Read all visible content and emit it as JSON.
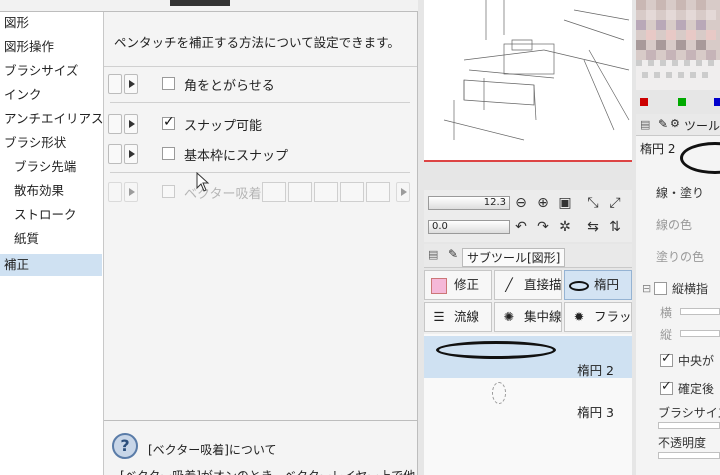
{
  "categories": [
    {
      "label": "図形",
      "sub": false,
      "selected": false
    },
    {
      "label": "図形操作",
      "sub": false,
      "selected": false
    },
    {
      "label": "ブラシサイズ",
      "sub": false,
      "selected": false
    },
    {
      "label": "インク",
      "sub": false,
      "selected": false
    },
    {
      "label": "アンチエイリアス",
      "sub": false,
      "selected": false
    },
    {
      "label": "ブラシ形状",
      "sub": false,
      "selected": false
    },
    {
      "label": "ブラシ先端",
      "sub": true,
      "selected": false
    },
    {
      "label": "散布効果",
      "sub": true,
      "selected": false
    },
    {
      "label": "ストローク",
      "sub": true,
      "selected": false
    },
    {
      "label": "紙質",
      "sub": true,
      "selected": false
    },
    {
      "label": "補正",
      "sub": false,
      "selected": true
    }
  ],
  "settings": {
    "description": "ペンタッチを補正する方法について設定できます。",
    "rows": [
      {
        "label": "角をとがらせる",
        "checked": false,
        "enabled": true
      },
      {
        "label": "スナップ可能",
        "checked": true,
        "enabled": true
      },
      {
        "label": "基本枠にスナップ",
        "checked": false,
        "enabled": true
      },
      {
        "label": "ベクター吸着",
        "checked": false,
        "enabled": false
      }
    ],
    "help_title": "[ベクター吸着]について",
    "help_body": "[ベクター吸着]がオンのとき、ベクターレイヤー上で他"
  },
  "navigator": {
    "zoom_value": "12.3",
    "rotate_value": "0.0"
  },
  "subtool": {
    "header_title": "サブツール[図形]",
    "tools": [
      {
        "label": "修正",
        "icon": "pink-square-icon",
        "selected": false
      },
      {
        "label": "直接描",
        "icon": "line-icon",
        "selected": false
      },
      {
        "label": "楕円",
        "icon": "ellipse-icon",
        "selected": true
      },
      {
        "label": "流線",
        "icon": "speed-lines-icon",
        "selected": false
      },
      {
        "label": "集中線",
        "icon": "focus-lines-icon",
        "selected": false
      },
      {
        "label": "フラッシュ",
        "icon": "flash-icon",
        "selected": false
      }
    ],
    "items": [
      {
        "label": "楕円 2",
        "selected": true
      },
      {
        "label": "楕円 3",
        "selected": false
      }
    ]
  },
  "tool_property": {
    "header_label": "ツール",
    "current_item": "楕円 2",
    "rows": [
      "線・塗り",
      "線の色",
      "塗りの色",
      "縦横指",
      "横",
      "縦",
      "中央が",
      "確定後",
      "ブラシサイズ",
      "不透明度"
    ]
  },
  "colors": {
    "selection": "#cfe1f2",
    "accent_red": "#d44"
  }
}
